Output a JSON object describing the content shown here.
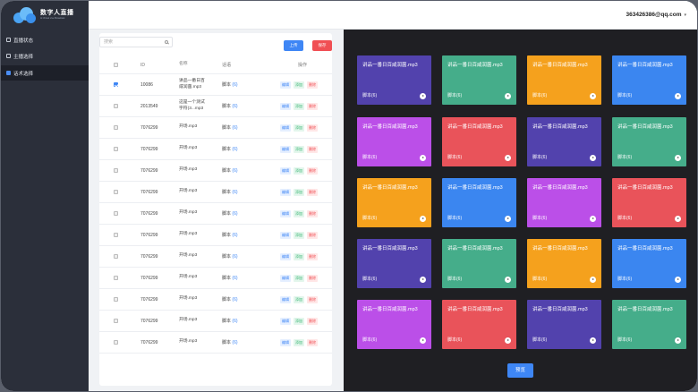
{
  "app": {
    "logo_title": "数字人直播",
    "logo_subtitle": "AI Virtual Live Broadcast"
  },
  "sidebar": {
    "items": [
      {
        "label": "直播状态",
        "icon": "monitor-icon"
      },
      {
        "label": "主播选择",
        "icon": "user-icon"
      },
      {
        "label": "话术选择",
        "icon": "chat-icon",
        "active": true
      }
    ]
  },
  "header": {
    "user": "363426386@qq.com"
  },
  "toolbar": {
    "search_placeholder": "搜索",
    "upload_label": "上传",
    "save_label": "保存"
  },
  "table": {
    "headers": [
      "ID",
      "名称",
      "话语",
      "操作"
    ],
    "op_labels": {
      "edit": "编辑",
      "add": "添加",
      "delete": "删除"
    },
    "script_prefix": "脚本",
    "rows": [
      {
        "id": "10086",
        "name": "讲品一番日百咸润菌.mp3",
        "script_num": "(6)",
        "checked": true
      },
      {
        "id": "2013549",
        "name": "这是一个测试字符(3...mp3",
        "script_num": "(6)",
        "checked": false
      },
      {
        "id": "7076299",
        "name": "开场.mp3",
        "script_num": "(6)",
        "checked": false
      },
      {
        "id": "7076299",
        "name": "开场.mp3",
        "script_num": "(6)",
        "checked": false
      },
      {
        "id": "7076299",
        "name": "开场.mp3",
        "script_num": "(6)",
        "checked": false
      },
      {
        "id": "7076299",
        "name": "开场.mp3",
        "script_num": "(6)",
        "checked": false
      },
      {
        "id": "7076299",
        "name": "开场.mp3",
        "script_num": "(6)",
        "checked": false
      },
      {
        "id": "7076299",
        "name": "开场.mp3",
        "script_num": "(6)",
        "checked": false
      },
      {
        "id": "7076299",
        "name": "开场.mp3",
        "script_num": "(6)",
        "checked": false
      },
      {
        "id": "7076299",
        "name": "开场.mp3",
        "script_num": "(6)",
        "checked": false
      },
      {
        "id": "7076299",
        "name": "开场.mp3",
        "script_num": "(6)",
        "checked": false
      },
      {
        "id": "7076299",
        "name": "开场.mp3",
        "script_num": "(6)",
        "checked": false
      },
      {
        "id": "7076299",
        "name": "开场.mp3",
        "script_num": "(6)",
        "checked": false
      }
    ]
  },
  "pagination": {
    "first": "«",
    "prev": "‹",
    "pages": [
      "1",
      "2",
      "3",
      "4",
      "5",
      "6"
    ],
    "current": "3",
    "next": "›",
    "last": "»",
    "total_prefix": "到总",
    "total": "12",
    "total_suffix": "页"
  },
  "tiles": {
    "title": "讲品一番日百咸润菌.mp3",
    "footer": "脚本(6)",
    "colors": {
      "purple": "#5242ad",
      "green": "#45ad8a",
      "orange": "#f5a11d",
      "blue": "#3b86f0",
      "violet": "#bb4fe8",
      "red": "#e9535a"
    },
    "grid": [
      [
        "purple",
        "green",
        "orange",
        "blue"
      ],
      [
        "violet",
        "red",
        "purple",
        "green"
      ],
      [
        "orange",
        "blue",
        "violet",
        "red"
      ],
      [
        "purple",
        "green",
        "orange",
        "blue"
      ],
      [
        "violet",
        "red",
        "purple",
        "green"
      ]
    ]
  },
  "preview_label": "预览"
}
